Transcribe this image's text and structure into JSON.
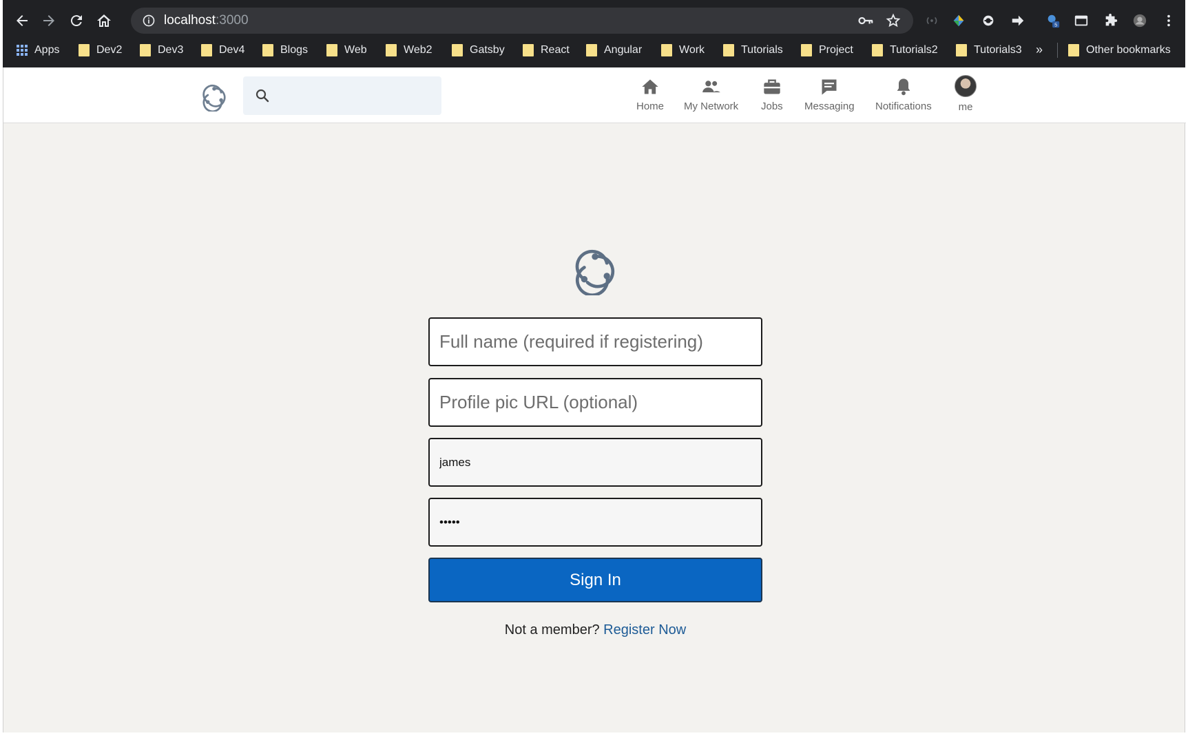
{
  "browser": {
    "url_host": "localhost",
    "url_port": ":3000",
    "extension_badge": "5",
    "bookmarks": [
      {
        "label": "Apps"
      },
      {
        "label": "Dev2"
      },
      {
        "label": "Dev3"
      },
      {
        "label": "Dev4"
      },
      {
        "label": "Blogs"
      },
      {
        "label": "Web"
      },
      {
        "label": "Web2"
      },
      {
        "label": "Gatsby"
      },
      {
        "label": "React"
      },
      {
        "label": "Angular"
      },
      {
        "label": "Work"
      },
      {
        "label": "Tutorials"
      },
      {
        "label": "Project"
      },
      {
        "label": "Tutorials2"
      },
      {
        "label": "Tutorials3"
      }
    ],
    "overflow": "»",
    "other_bookmarks": "Other bookmarks"
  },
  "header": {
    "search_placeholder": "",
    "nav": [
      {
        "label": "Home",
        "icon": "home-icon"
      },
      {
        "label": "My Network",
        "icon": "network-icon"
      },
      {
        "label": "Jobs",
        "icon": "briefcase-icon"
      },
      {
        "label": "Messaging",
        "icon": "message-icon"
      },
      {
        "label": "Notifications",
        "icon": "bell-icon"
      },
      {
        "label": "me",
        "icon": "avatar"
      }
    ]
  },
  "login": {
    "fullname_placeholder": "Full name (required if registering)",
    "profile_pic_placeholder": "Profile pic URL (optional)",
    "email_value": "james",
    "password_value": "•••••",
    "signin_label": "Sign In",
    "register_prompt": "Not a member?",
    "register_link": "Register Now"
  },
  "colors": {
    "primary_button": "#0a66c2",
    "link": "#1d5b96",
    "page_background": "#f3f2ef",
    "chrome_background": "#202124"
  }
}
